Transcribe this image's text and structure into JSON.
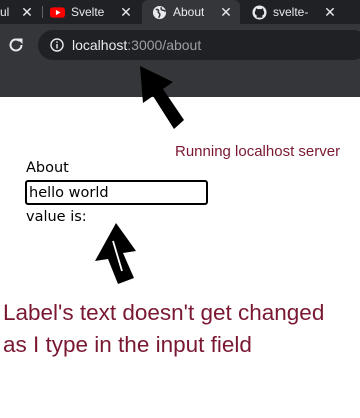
{
  "browser": {
    "tabs": [
      {
        "label": "ul",
        "favicon": "page-icon",
        "active": false
      },
      {
        "label": "Svelte",
        "favicon": "youtube-icon",
        "active": false
      },
      {
        "label": "About",
        "favicon": "globe-icon",
        "active": true
      },
      {
        "label": "svelte-",
        "favicon": "github-icon",
        "active": false
      }
    ],
    "url_host": "localhost",
    "url_rest": ":3000/about"
  },
  "page": {
    "heading": "About",
    "input_value": "hello world",
    "value_label": "value is:"
  },
  "annotations": {
    "server_note": "Running localhost server",
    "bug_note_line1": "Label's text doesn't get changed",
    "bug_note_line2": "as I type in the input field",
    "color": "#7a1832"
  }
}
